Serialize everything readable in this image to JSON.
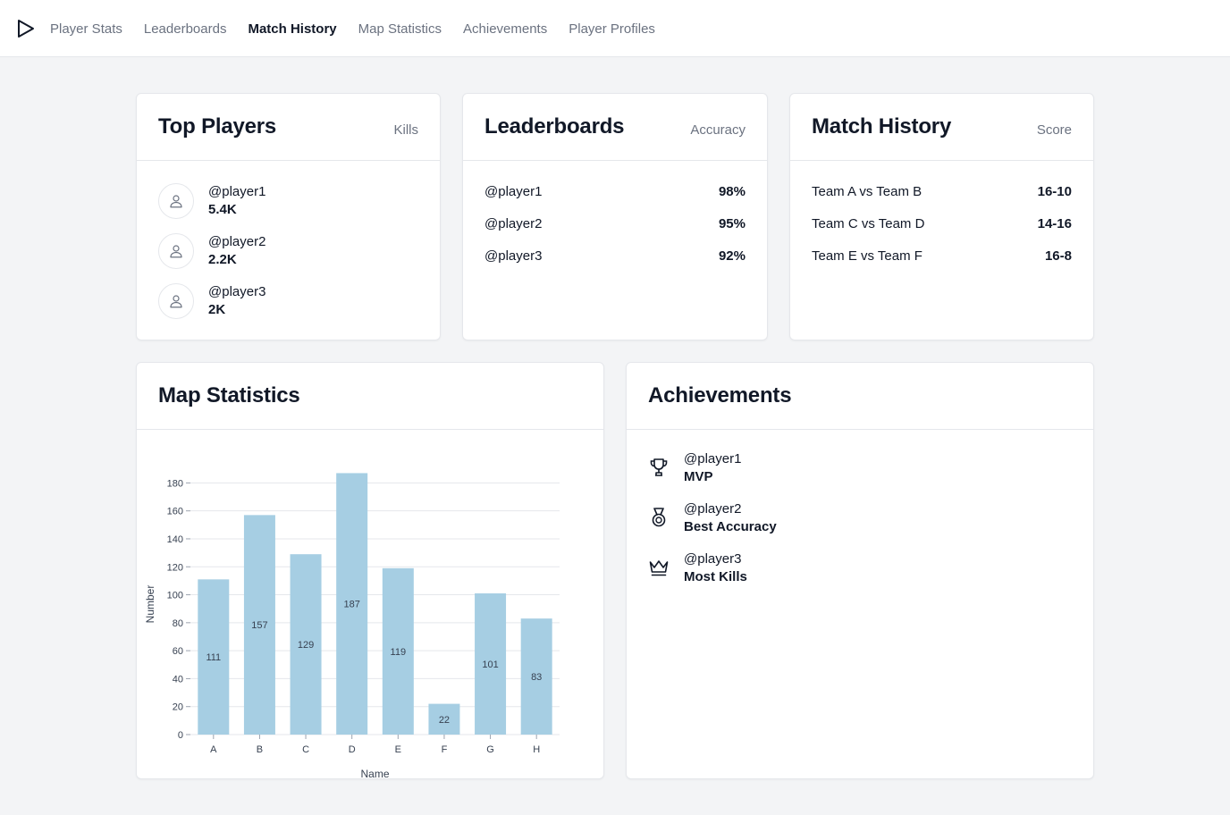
{
  "nav": {
    "logo_icon": "play-triangle-icon",
    "items": [
      {
        "label": "Player Stats",
        "active": false
      },
      {
        "label": "Leaderboards",
        "active": false
      },
      {
        "label": "Match History",
        "active": true
      },
      {
        "label": "Map Statistics",
        "active": false
      },
      {
        "label": "Achievements",
        "active": false
      },
      {
        "label": "Player Profiles",
        "active": false
      }
    ]
  },
  "top_players": {
    "title": "Top Players",
    "meta": "Kills",
    "items": [
      {
        "handle": "@player1",
        "value": "5.4K",
        "icon": "user-icon"
      },
      {
        "handle": "@player2",
        "value": "2.2K",
        "icon": "user-icon"
      },
      {
        "handle": "@player3",
        "value": "2K",
        "icon": "user-icon"
      }
    ]
  },
  "leaderboards": {
    "title": "Leaderboards",
    "meta": "Accuracy",
    "rows": [
      {
        "handle": "@player1",
        "value": "98%"
      },
      {
        "handle": "@player2",
        "value": "95%"
      },
      {
        "handle": "@player3",
        "value": "92%"
      }
    ]
  },
  "match_history": {
    "title": "Match History",
    "meta": "Score",
    "rows": [
      {
        "match": "Team A vs Team B",
        "score": "16-10"
      },
      {
        "match": "Team C vs Team D",
        "score": "14-16"
      },
      {
        "match": "Team E vs Team F",
        "score": "16-8"
      }
    ]
  },
  "map_statistics": {
    "title": "Map Statistics"
  },
  "achievements": {
    "title": "Achievements",
    "items": [
      {
        "handle": "@player1",
        "title": "MVP",
        "icon": "trophy-icon"
      },
      {
        "handle": "@player2",
        "title": "Best Accuracy",
        "icon": "medal-icon"
      },
      {
        "handle": "@player3",
        "title": "Most Kills",
        "icon": "crown-icon"
      }
    ]
  },
  "colors": {
    "bar_fill": "#a6cee3",
    "grid": "#e5e7eb",
    "text": "#111827",
    "muted": "#6b7280",
    "background": "#f3f4f6"
  },
  "chart_data": {
    "type": "bar",
    "categories": [
      "A",
      "B",
      "C",
      "D",
      "E",
      "F",
      "G",
      "H"
    ],
    "values": [
      111,
      157,
      129,
      187,
      119,
      22,
      101,
      83
    ],
    "xlabel": "Name",
    "ylabel": "Number",
    "ylim": [
      0,
      190
    ],
    "yticks": [
      0,
      20,
      40,
      60,
      80,
      100,
      120,
      140,
      160,
      180
    ],
    "grid": true,
    "legend": false
  }
}
